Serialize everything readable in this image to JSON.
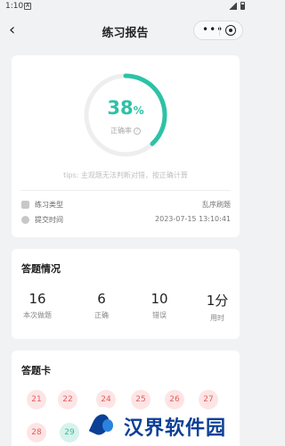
{
  "status_bar": {
    "time": "1:10",
    "notification_glyph": "A"
  },
  "header": {
    "title": "练习报告",
    "capsule_more": "•••"
  },
  "summary": {
    "accuracy_fraction": 0.38,
    "accuracy_value": "38",
    "accuracy_unit": "%",
    "accuracy_label": "正确率",
    "tips": "tips: 主观题无法判断对错，按正确计算",
    "practice_type_label": "练习类型",
    "practice_type_value": "乱序刷题",
    "submit_time_label": "提交时间",
    "submit_time_value": "2023-07-15 13:10:41"
  },
  "answers": {
    "title": "答题情况",
    "stats": [
      {
        "value": "16",
        "label": "本次做题"
      },
      {
        "value": "6",
        "label": "正确"
      },
      {
        "value": "10",
        "label": "错误"
      },
      {
        "value": "1分",
        "label": "用时"
      }
    ]
  },
  "answer_card": {
    "title": "答题卡",
    "items": [
      {
        "number": "21",
        "state": "wrong"
      },
      {
        "number": "22",
        "state": "wrong"
      },
      {
        "number": "24",
        "state": "wrong"
      },
      {
        "number": "25",
        "state": "wrong"
      },
      {
        "number": "26",
        "state": "wrong"
      },
      {
        "number": "27",
        "state": "wrong"
      },
      {
        "number": "28",
        "state": "wrong"
      },
      {
        "number": "29",
        "state": "correct"
      }
    ]
  },
  "watermark": {
    "text": "汉界软件园"
  },
  "colors": {
    "accent": "#2dc2a6",
    "wrong": "#e65c5c",
    "wrong_bg": "#fde5e5",
    "page_bg": "#f1f2f4",
    "watermark": "#0c3f96"
  }
}
